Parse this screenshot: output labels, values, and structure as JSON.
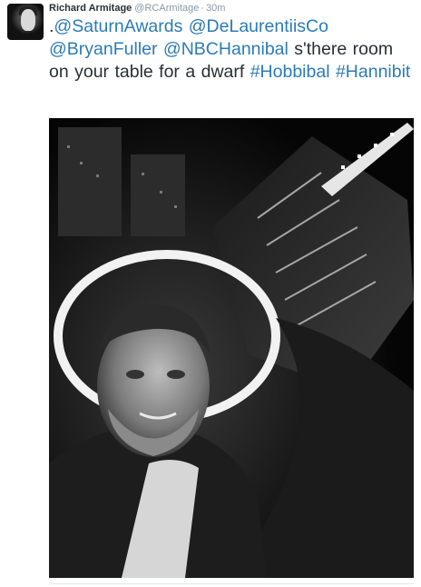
{
  "tweet": {
    "author_name": "Richard Armitage",
    "author_handle": "@RCArmitage",
    "separator": "·",
    "timestamp": "30m",
    "text_segments": [
      {
        "text": ".",
        "link": false
      },
      {
        "text": "@SaturnAwards",
        "link": true
      },
      {
        "text": " ",
        "link": false
      },
      {
        "text": "@DeLaurentiisCo",
        "link": true
      },
      {
        "text": " ",
        "link": false
      },
      {
        "text": "@BryanFuller",
        "link": true
      },
      {
        "text": " ",
        "link": false
      },
      {
        "text": "@NBCHannibal",
        "link": true
      },
      {
        "text": " s'there room on your table for a dwarf ",
        "link": false
      },
      {
        "text": "#Hobbibal",
        "link": true
      },
      {
        "text": " ",
        "link": false
      },
      {
        "text": "#Hannibit",
        "link": true
      }
    ],
    "link_color": "#2b7bb9",
    "text_color": "#292f33",
    "meta_color": "#8899a6"
  },
  "media": {
    "kind": "photo",
    "style": "black-and-white selfie, city skyline at night with illuminated tower in background"
  }
}
